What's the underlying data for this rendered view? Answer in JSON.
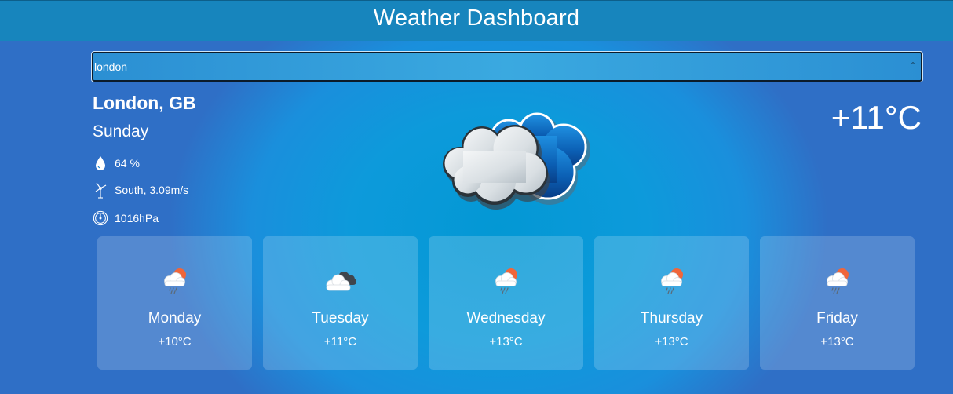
{
  "app": {
    "title": "Weather Dashboard"
  },
  "search": {
    "value": "london",
    "placeholder": ""
  },
  "current": {
    "city": "London, GB",
    "day": "Sunday",
    "humidity": "64 %",
    "wind": "South, 3.09m/s",
    "pressure": "1016hPa",
    "temperature": "+11°C",
    "icon": "cloudy-icon"
  },
  "forecast": [
    {
      "day": "Monday",
      "temp": "+10°C",
      "icon": "sun-cloud-rain-icon"
    },
    {
      "day": "Tuesday",
      "temp": "+11°C",
      "icon": "dark-cloud-icon"
    },
    {
      "day": "Wednesday",
      "temp": "+13°C",
      "icon": "sun-cloud-rain-icon"
    },
    {
      "day": "Thursday",
      "temp": "+13°C",
      "icon": "sun-cloud-rain-icon"
    },
    {
      "day": "Friday",
      "temp": "+13°C",
      "icon": "sun-cloud-rain-icon"
    }
  ],
  "colors": {
    "header": "#1785bd",
    "background": "#1e86d6",
    "sun": "#f26b3a",
    "text": "#ffffff"
  }
}
